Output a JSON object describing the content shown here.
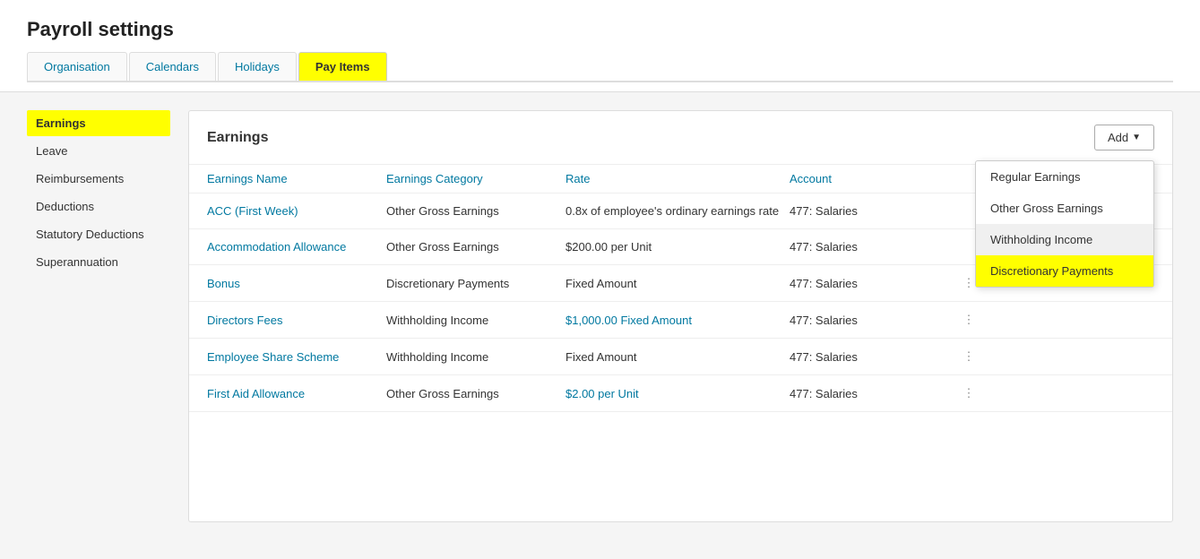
{
  "page": {
    "title": "Payroll settings"
  },
  "tabs": [
    {
      "id": "organisation",
      "label": "Organisation",
      "active": false
    },
    {
      "id": "calendars",
      "label": "Calendars",
      "active": false
    },
    {
      "id": "holidays",
      "label": "Holidays",
      "active": false
    },
    {
      "id": "pay-items",
      "label": "Pay Items",
      "active": true
    }
  ],
  "sidebar": {
    "items": [
      {
        "id": "earnings",
        "label": "Earnings",
        "active": true
      },
      {
        "id": "leave",
        "label": "Leave",
        "active": false
      },
      {
        "id": "reimbursements",
        "label": "Reimbursements",
        "active": false
      },
      {
        "id": "deductions",
        "label": "Deductions",
        "active": false
      },
      {
        "id": "statutory-deductions",
        "label": "Statutory Deductions",
        "active": false
      },
      {
        "id": "superannuation",
        "label": "Superannuation",
        "active": false
      }
    ]
  },
  "main": {
    "title": "Earnings",
    "add_button": "Add",
    "columns": [
      {
        "id": "earnings-name",
        "label": "Earnings Name"
      },
      {
        "id": "earnings-category",
        "label": "Earnings Category"
      },
      {
        "id": "rate",
        "label": "Rate"
      },
      {
        "id": "account",
        "label": "Account"
      },
      {
        "id": "actions",
        "label": ""
      }
    ],
    "rows": [
      {
        "name": "ACC (First Week)",
        "category": "Other Gross Earnings",
        "rate": "0.8x of employee's ordinary earnings rate",
        "account": "477: Salaries",
        "has_actions": false
      },
      {
        "name": "Accommodation Allowance",
        "category": "Other Gross Earnings",
        "rate": "$200.00 per Unit",
        "account": "477: Salaries",
        "has_actions": false
      },
      {
        "name": "Bonus",
        "category": "Discretionary Payments",
        "rate": "Fixed Amount",
        "account": "477: Salaries",
        "has_actions": true
      },
      {
        "name": "Directors Fees",
        "category": "Withholding Income",
        "rate": "$1,000.00 Fixed Amount",
        "account": "477: Salaries",
        "has_actions": true
      },
      {
        "name": "Employee Share Scheme",
        "category": "Withholding Income",
        "rate": "Fixed Amount",
        "account": "477: Salaries",
        "has_actions": true
      },
      {
        "name": "First Aid Allowance",
        "category": "Other Gross Earnings",
        "rate": "$2.00 per Unit",
        "account": "477: Salaries",
        "has_actions": true
      }
    ],
    "dropdown": {
      "items": [
        {
          "id": "regular-earnings",
          "label": "Regular Earnings",
          "highlighted": false
        },
        {
          "id": "other-gross-earnings",
          "label": "Other Gross Earnings",
          "highlighted": false
        },
        {
          "id": "withholding-income",
          "label": "Withholding Income",
          "highlighted": false,
          "hovered": true
        },
        {
          "id": "discretionary-payments",
          "label": "Discretionary Payments",
          "highlighted": true
        }
      ]
    }
  }
}
